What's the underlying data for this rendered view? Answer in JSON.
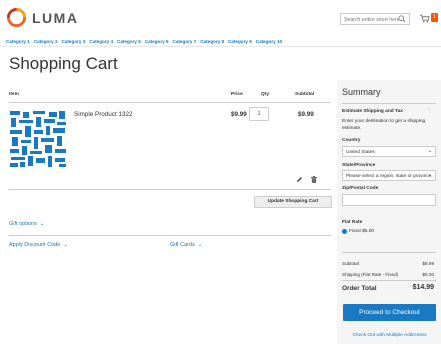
{
  "header": {
    "logo_text": "LUMA",
    "search_placeholder": "Search entire store here...",
    "cart_count": "1"
  },
  "nav": [
    "Category 1",
    "Category 2",
    "Category 3",
    "Category 4",
    "Category 5",
    "Category 6",
    "Category 7",
    "Category 8",
    "Category 9",
    "Category 10"
  ],
  "page_title": "Shopping Cart",
  "cart": {
    "headers": {
      "item": "Item",
      "price": "Price",
      "qty": "Qty",
      "subtotal": "Subtotal"
    },
    "items": [
      {
        "name": "Simple Product 1322",
        "price": "$9.99",
        "qty": "1",
        "subtotal": "$9.99"
      }
    ],
    "update_label": "Update Shopping Cart",
    "gift_options": "Gift options",
    "apply_discount": "Apply Discount Code",
    "gift_cards": "Gift Cards"
  },
  "summary": {
    "title": "Summary",
    "estimate_title": "Estimate Shipping and Tax",
    "estimate_desc": "Enter your destination to get a shipping estimate.",
    "country_label": "Country",
    "country_value": "United States",
    "state_label": "State/Province",
    "state_value": "Please select a region, state or province.",
    "zip_label": "Zip/Postal Code",
    "flat_rate_title": "Flat Rate",
    "flat_rate_option": "Fixed $5.00",
    "subtotal_label": "Subtotal",
    "subtotal_value": "$9.99",
    "shipping_label": "Shipping (Flat Rate - Fixed)",
    "shipping_value": "$5.00",
    "order_total_label": "Order Total",
    "order_total_value": "$14.99",
    "checkout_label": "Proceed to Checkout",
    "multi_label": "Check Out with Multiple Addresses"
  },
  "colors": {
    "accent": "#1979c3",
    "cart_badge": "#ff5501"
  }
}
